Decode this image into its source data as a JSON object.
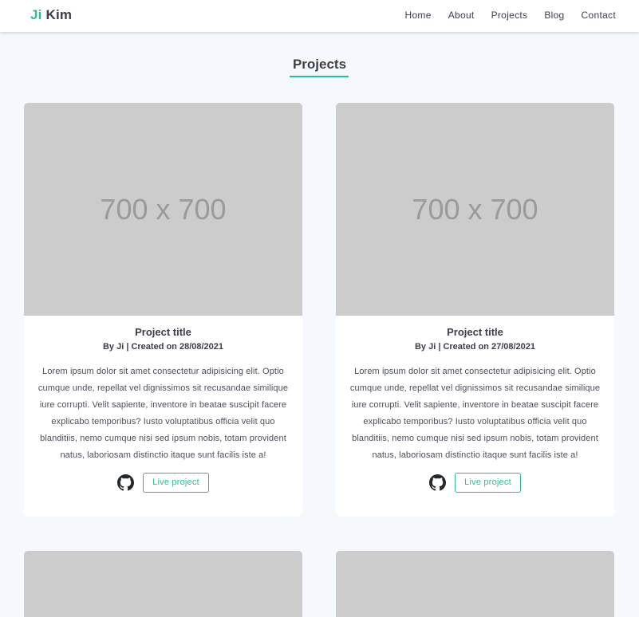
{
  "brand": {
    "first": "Ji",
    "last": "Kim"
  },
  "nav": {
    "items": [
      {
        "label": "Home"
      },
      {
        "label": "About"
      },
      {
        "label": "Projects"
      },
      {
        "label": "Blog"
      },
      {
        "label": "Contact"
      }
    ]
  },
  "page": {
    "title": "Projects"
  },
  "projects": [
    {
      "image_text": "700 x 700",
      "title": "Project title",
      "meta": "By Ji | Created on 28/08/2021",
      "description": "Lorem ipsum dolor sit amet consectetur adipisicing elit. Optio cumque unde, repellat vel dignissimos sit recusandae similique iure corrupti. Velit sapiente, inventore in beatae suscipit facere explicabo temporibus? Iusto voluptatibus officia velit quo blanditiis, nemo cumque nisi sed ipsum nobis, totam provident natus, laboriosam distinctio itaque sunt facilis iste a!",
      "live_label": "Live project",
      "repo_icon": "github-icon"
    },
    {
      "image_text": "700 x 700",
      "title": "Project title",
      "meta": "By Ji | Created on 27/08/2021",
      "description": "Lorem ipsum dolor sit amet consectetur adipisicing elit. Optio cumque unde, repellat vel dignissimos sit recusandae similique iure corrupti. Velit sapiente, inventore in beatae suscipit facere explicabo temporibus? Iusto voluptatibus officia velit quo blanditiis, nemo cumque nisi sed ipsum nobis, totam provident natus, laboriosam distinctio itaque sunt facilis iste a!",
      "live_label": "Live project",
      "repo_icon": "github-icon"
    }
  ],
  "colors": {
    "accent": "#2ebd8e",
    "background": "#f5f9fd",
    "placeholder": "#cccccc",
    "text": "#3a3f4b"
  }
}
